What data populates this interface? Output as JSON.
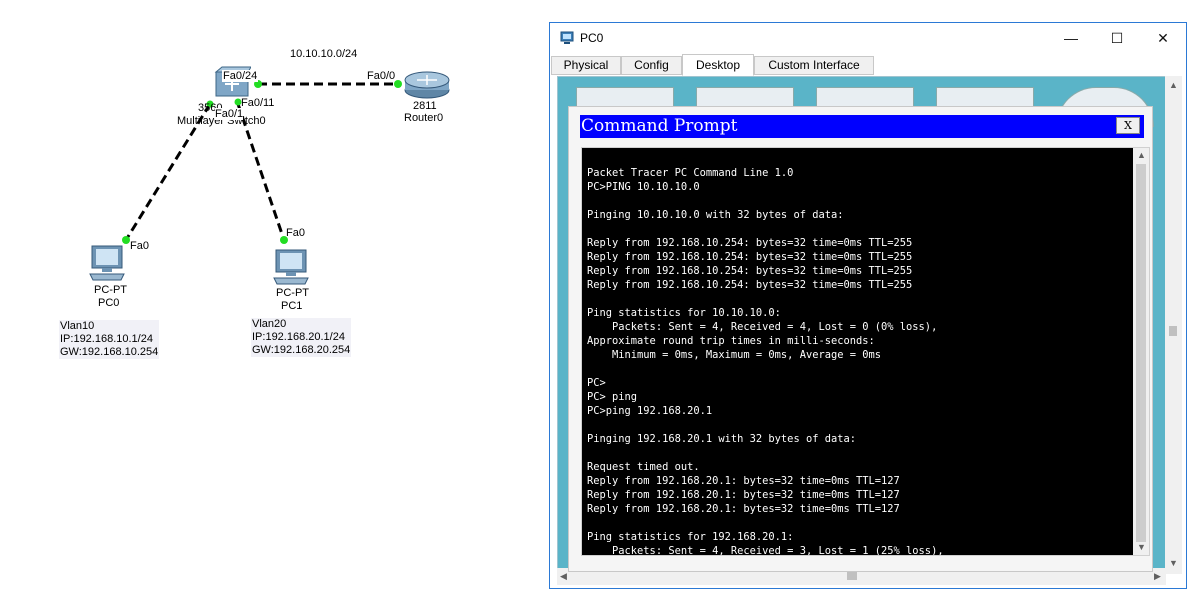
{
  "topology": {
    "network_label": "10.10.10.0/24",
    "switch": {
      "name_lines": [
        "3560",
        "Multilayer Switch0"
      ],
      "ports": {
        "fa0_24": "Fa0/24",
        "fa0_11": "Fa0/11",
        "fa0_1": "Fa0/1"
      }
    },
    "router": {
      "model": "2811",
      "name": "Router0",
      "port": "Fa0/0"
    },
    "pc0": {
      "type": "PC-PT",
      "name": "PC0",
      "port": "Fa0",
      "note": [
        "Vlan10",
        "IP:192.168.10.1/24",
        "GW:192.168.10.254"
      ]
    },
    "pc1": {
      "type": "PC-PT",
      "name": "PC1",
      "port": "Fa0",
      "note": [
        "Vlan20",
        "IP:192.168.20.1/24",
        "GW:192.168.20.254"
      ]
    },
    "colors": {
      "link": "#000000",
      "port_up": "#22dd22"
    }
  },
  "window": {
    "title": "PC0",
    "icon": "pc-app-icon",
    "controls": {
      "minimize": "—",
      "maximize": "☐",
      "close": "✕"
    },
    "tabs": [
      "Physical",
      "Config",
      "Desktop",
      "Custom Interface"
    ],
    "active_tab": "Desktop"
  },
  "command_prompt": {
    "title": "Command Prompt",
    "close_label": "X",
    "lines": [
      "Packet Tracer PC Command Line 1.0",
      "PC>PING 10.10.10.0",
      "",
      "Pinging 10.10.10.0 with 32 bytes of data:",
      "",
      "Reply from 192.168.10.254: bytes=32 time=0ms TTL=255",
      "Reply from 192.168.10.254: bytes=32 time=0ms TTL=255",
      "Reply from 192.168.10.254: bytes=32 time=0ms TTL=255",
      "Reply from 192.168.10.254: bytes=32 time=0ms TTL=255",
      "",
      "Ping statistics for 10.10.10.0:",
      "    Packets: Sent = 4, Received = 4, Lost = 0 (0% loss),",
      "Approximate round trip times in milli-seconds:",
      "    Minimum = 0ms, Maximum = 0ms, Average = 0ms",
      "",
      "PC>",
      "PC> ping",
      "PC>ping 192.168.20.1",
      "",
      "Pinging 192.168.20.1 with 32 bytes of data:",
      "",
      "Request timed out.",
      "Reply from 192.168.20.1: bytes=32 time=0ms TTL=127",
      "Reply from 192.168.20.1: bytes=32 time=0ms TTL=127",
      "Reply from 192.168.20.1: bytes=32 time=0ms TTL=127",
      "",
      "Ping statistics for 192.168.20.1:",
      "    Packets: Sent = 4, Received = 3, Lost = 1 (25% loss),"
    ]
  }
}
